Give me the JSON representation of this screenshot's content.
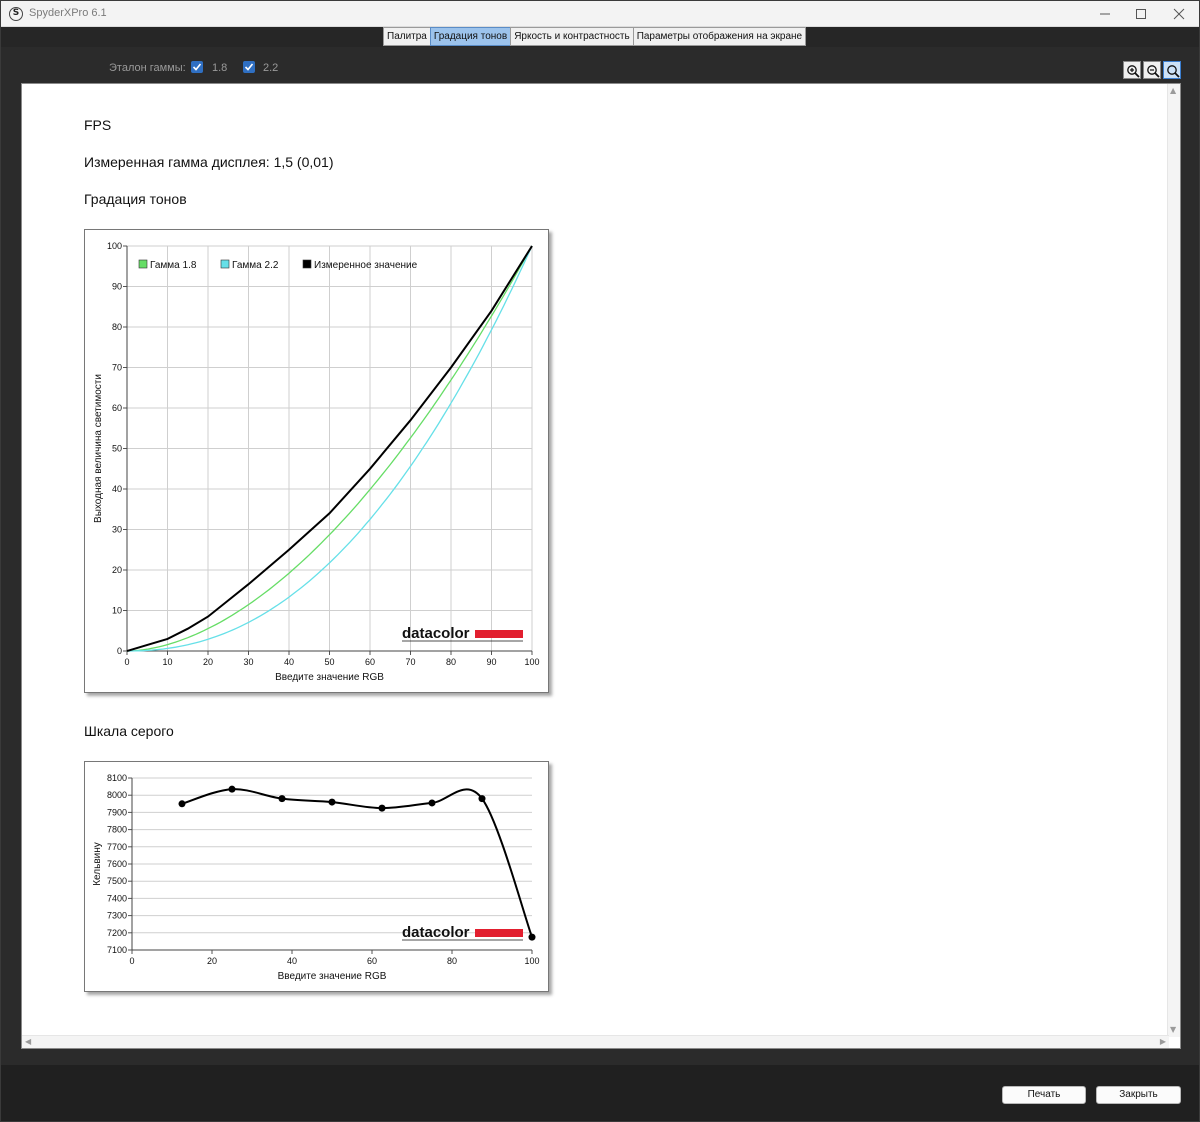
{
  "window": {
    "title": "SpyderXPro 6.1",
    "app_icon_letter": "S"
  },
  "tabs": [
    {
      "label": "Палитра",
      "active": false
    },
    {
      "label": "Градация тонов",
      "active": true
    },
    {
      "label": "Яркость и контрастность",
      "active": false
    },
    {
      "label": "Параметры отображения на экране",
      "active": false
    }
  ],
  "toolbar": {
    "gamma_label": "Эталон гаммы:",
    "checkbox_1": {
      "label": "1.8",
      "checked": true
    },
    "checkbox_2": {
      "label": "2.2",
      "checked": true
    },
    "zoom_buttons": [
      "zoom-in-icon",
      "zoom-out-icon",
      "zoom-fit-icon"
    ]
  },
  "report": {
    "display_name": "FPS",
    "measured_gamma": "Измеренная гамма дисплея: 1,5 (0,01)",
    "tone_section_title": "Градация тонов",
    "gray_section_title": "Шкала серого"
  },
  "brand_logo": "datacolor",
  "colors": {
    "gamma18": "#66dd66",
    "gamma22": "#66e0e8",
    "measured": "#000000",
    "brand_red": "#e21f2f",
    "tab_active": "#9cc3ec"
  },
  "chart_data": [
    {
      "type": "line",
      "xlabel": "Введите значение RGB",
      "ylabel": "Выходная величина светимости",
      "xlim": [
        0,
        100
      ],
      "ylim": [
        0,
        100
      ],
      "x_ticks": [
        "0",
        "10",
        "20",
        "30",
        "40",
        "50",
        "60",
        "70",
        "80",
        "90",
        "100"
      ],
      "y_ticks": [
        "0",
        "10",
        "20",
        "30",
        "40",
        "50",
        "60",
        "70",
        "80",
        "90",
        "100"
      ],
      "grid": true,
      "legend_position": "top-left",
      "series": [
        {
          "name": "Гамма 1.8",
          "gamma": 1.8,
          "color": "#66dd66"
        },
        {
          "name": "Гамма 2.2",
          "gamma": 2.2,
          "color": "#66e0e8"
        },
        {
          "name": "Измеренное значение",
          "color": "#000000",
          "x": [
            0,
            5,
            10,
            15,
            20,
            25,
            30,
            40,
            50,
            60,
            70,
            80,
            90,
            100
          ],
          "y": [
            0,
            1.5,
            3,
            5.5,
            8.5,
            12.5,
            16.5,
            25,
            34,
            45,
            57,
            70,
            84,
            100
          ]
        }
      ]
    },
    {
      "type": "line",
      "xlabel": "Введите значение RGB",
      "ylabel": "Кельвину",
      "xlim": [
        0,
        100
      ],
      "ylim": [
        7100,
        8100
      ],
      "x_ticks": [
        "0",
        "20",
        "40",
        "60",
        "80",
        "100"
      ],
      "y_ticks": [
        "7100",
        "7200",
        "7300",
        "7400",
        "7500",
        "7600",
        "7700",
        "7800",
        "7900",
        "8000",
        "8100"
      ],
      "grid": true,
      "series": [
        {
          "x": [
            12.5,
            25,
            37.5,
            50,
            62.5,
            75,
            87.5,
            100
          ],
          "y": [
            7950,
            8035,
            7980,
            7960,
            7925,
            7955,
            7980,
            7175
          ]
        }
      ]
    }
  ],
  "footer": {
    "print_label": "Печать",
    "close_label": "Закрыть"
  }
}
